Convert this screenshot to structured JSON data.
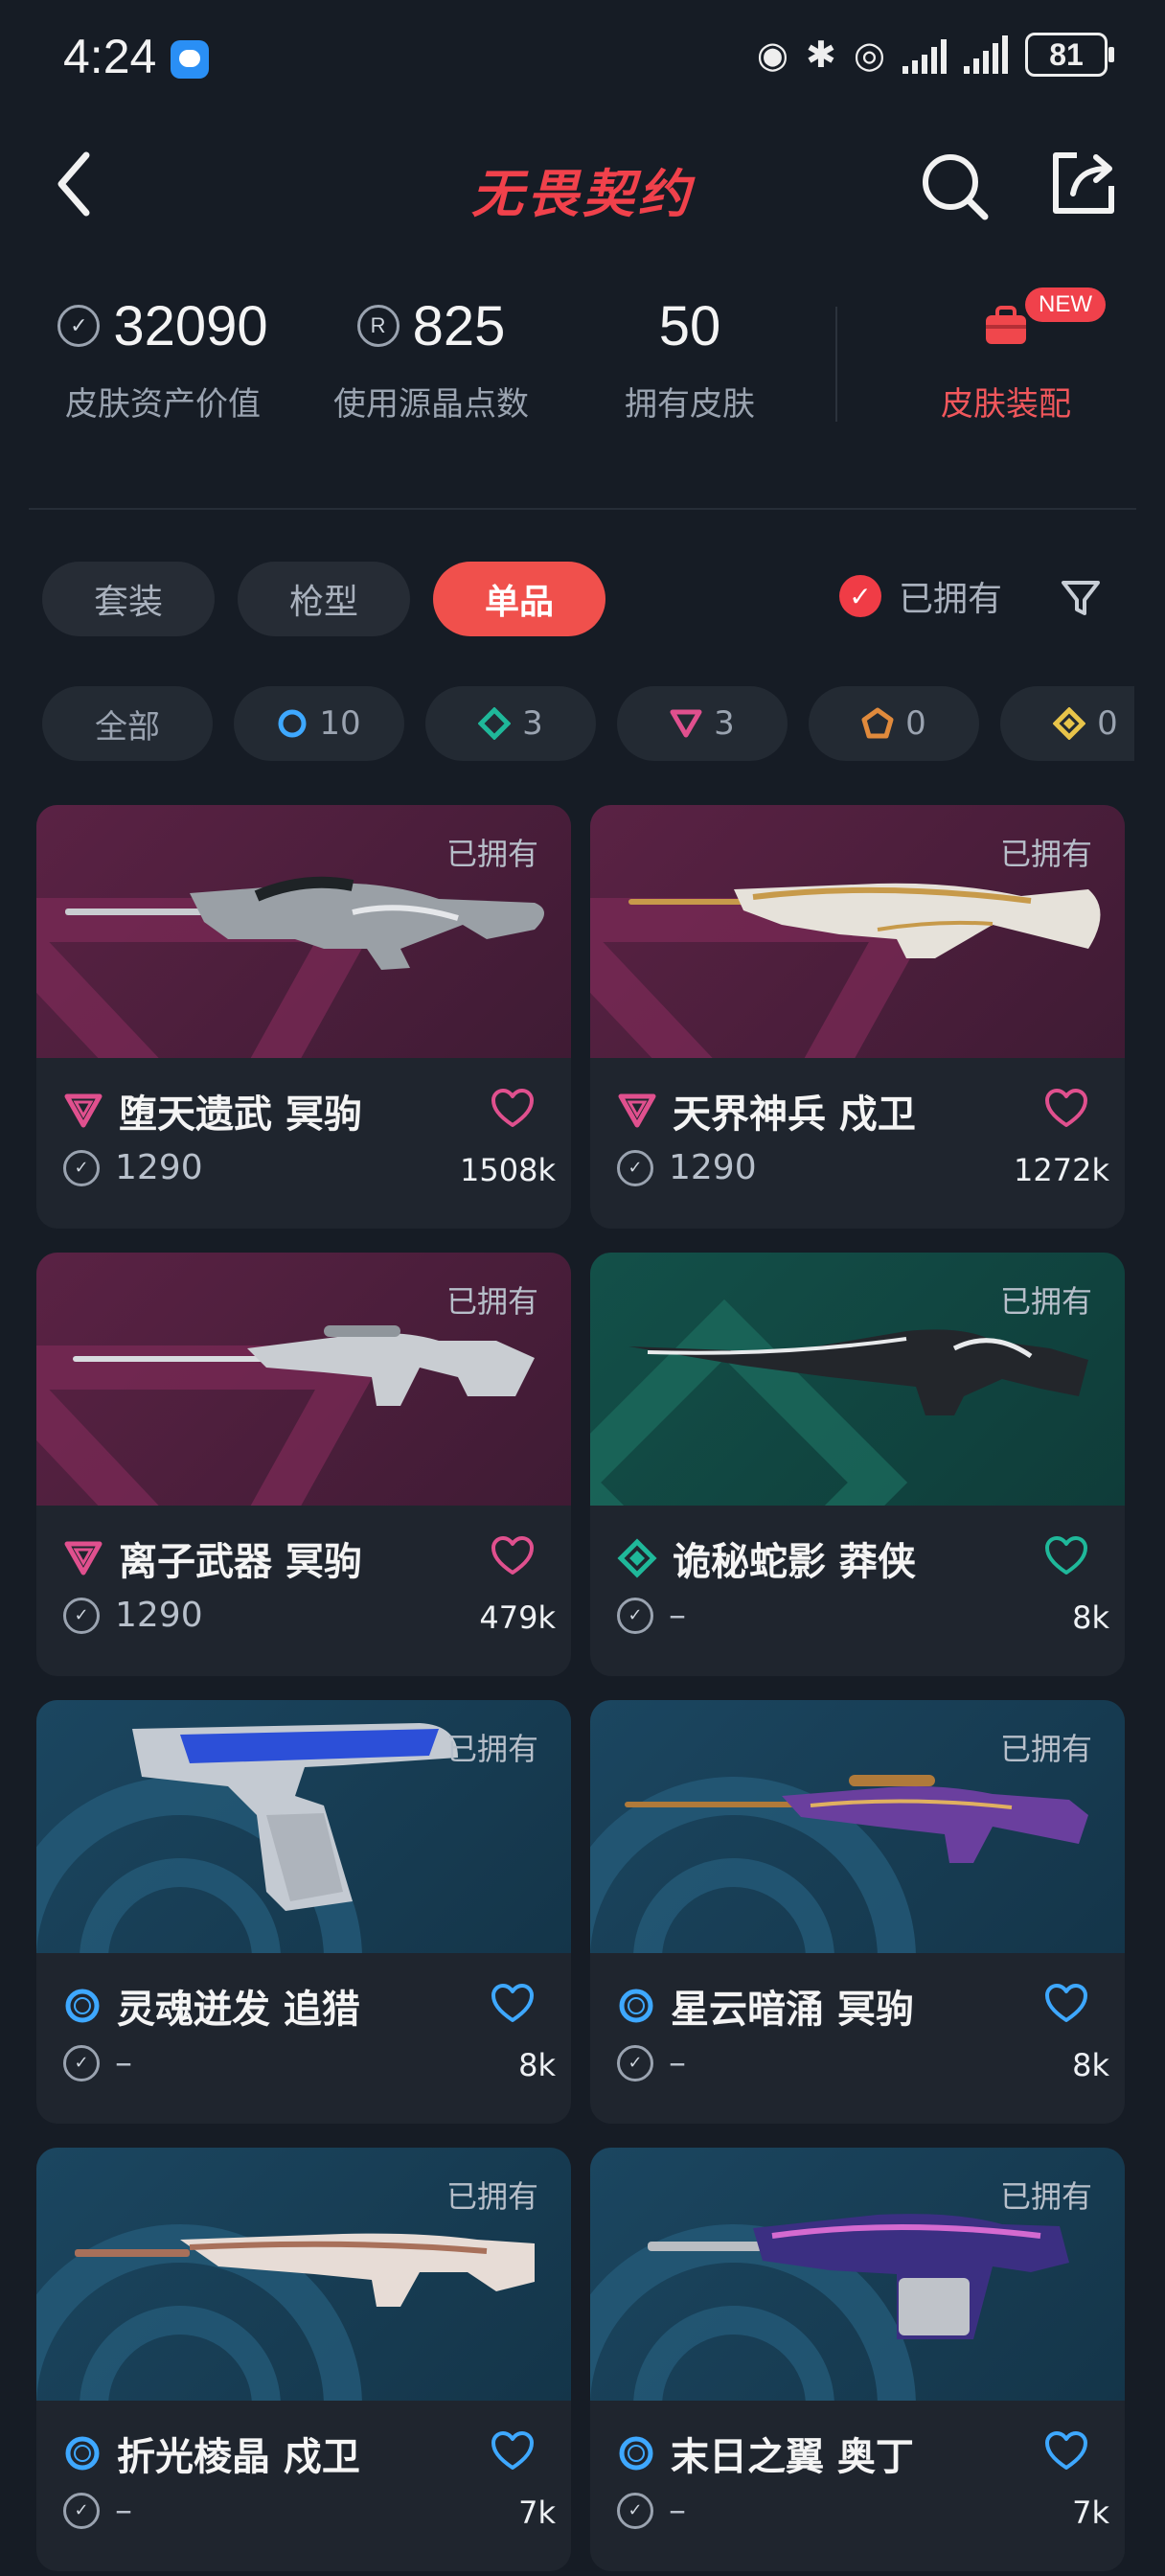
{
  "status": {
    "time": "4:24",
    "battery": "81"
  },
  "header": {
    "title": "无畏契约"
  },
  "stats": {
    "asset_value": "32090",
    "asset_label": "皮肤资产价值",
    "radianite": "825",
    "radianite_label": "使用源晶点数",
    "owned_count": "50",
    "owned_label": "拥有皮肤",
    "equip_label": "皮肤装配",
    "new_badge": "NEW"
  },
  "tabs": [
    "套装",
    "枪型",
    "单品"
  ],
  "active_tab": "单品",
  "owned_filter": "已拥有",
  "chips": [
    {
      "label": "全部",
      "icon": "all"
    },
    {
      "label": "10",
      "icon": "select-tier-icon",
      "color": "#3ea8ff"
    },
    {
      "label": "3",
      "icon": "deluxe-tier-icon",
      "color": "#1fb89a"
    },
    {
      "label": "3",
      "icon": "premium-tier-icon",
      "color": "#e0508e"
    },
    {
      "label": "0",
      "icon": "exclusive-tier-icon",
      "color": "#e08a3c"
    },
    {
      "label": "0",
      "icon": "ultra-tier-icon",
      "color": "#e8c44a"
    }
  ],
  "cards": [
    {
      "tag": "已拥有",
      "name": "堕天遗武 冥驹",
      "price": "1290",
      "likes": "1508k",
      "tier": "premium",
      "bg": "purple",
      "heart_color": "#e0508e"
    },
    {
      "tag": "已拥有",
      "name": "天界神兵 戍卫",
      "price": "1290",
      "likes": "1272k",
      "tier": "premium",
      "bg": "purple",
      "heart_color": "#e0508e"
    },
    {
      "tag": "已拥有",
      "name": "离子武器 冥驹",
      "price": "1290",
      "likes": "479k",
      "tier": "premium",
      "bg": "purple",
      "heart_color": "#e0508e"
    },
    {
      "tag": "已拥有",
      "name": "诡秘蛇影 莽侠",
      "price": "–",
      "likes": "8k",
      "tier": "deluxe",
      "bg": "green",
      "heart_color": "#1fb89a"
    },
    {
      "tag": "已拥有",
      "name": "灵魂迸发 追猎",
      "price": "–",
      "likes": "8k",
      "tier": "select",
      "bg": "blue",
      "heart_color": "#3ea8ff"
    },
    {
      "tag": "已拥有",
      "name": "星云暗涌 冥驹",
      "price": "–",
      "likes": "8k",
      "tier": "select",
      "bg": "blue",
      "heart_color": "#3ea8ff"
    },
    {
      "tag": "已拥有",
      "name": "折光棱晶 戍卫",
      "price": "–",
      "likes": "7k",
      "tier": "select",
      "bg": "blue",
      "heart_color": "#3ea8ff"
    },
    {
      "tag": "已拥有",
      "name": "末日之翼 奥丁",
      "price": "–",
      "likes": "7k",
      "tier": "select",
      "bg": "blue",
      "heart_color": "#3ea8ff"
    }
  ]
}
